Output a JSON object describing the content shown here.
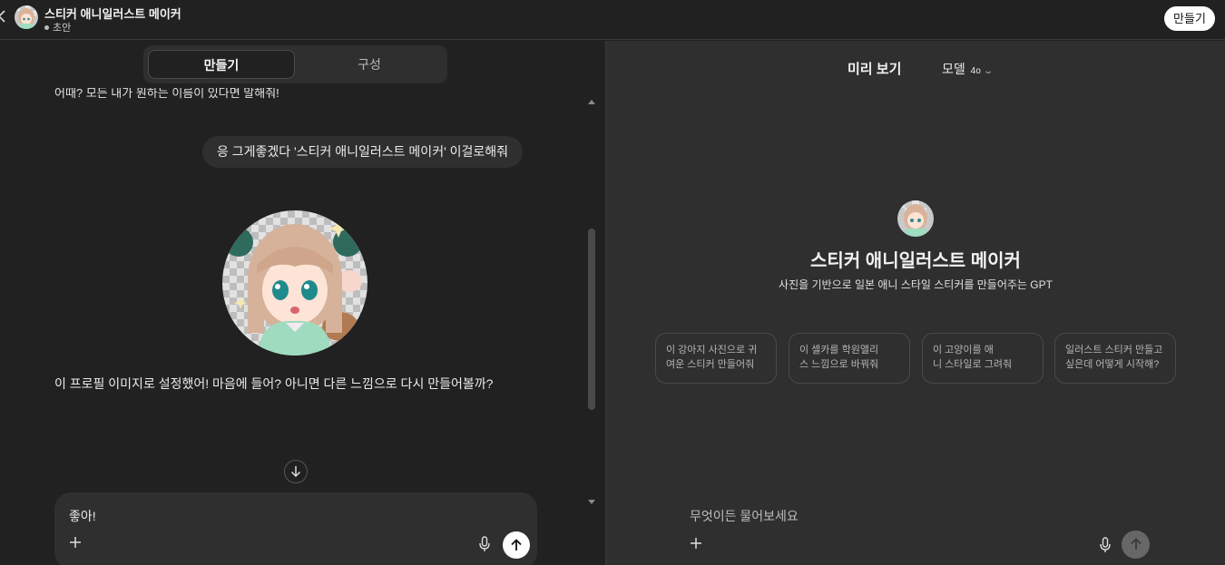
{
  "header": {
    "title": "스티커 애니일러스트 메이커",
    "status": "초안",
    "create_label": "만들기"
  },
  "builder": {
    "tabs": [
      {
        "label": "만들기",
        "active": true
      },
      {
        "label": "구성",
        "active": false
      }
    ],
    "partial_message": "어때? 모든 내가 원하는 이름이 있다면 말해줘!",
    "user_message": "응 그게좋겠다 '스티커 애니일러스트 메이커' 이걸로해줘",
    "assistant_message": "이 프로필 이미지로 설정했어! 마음에 들어? 아니면 다른 느낌으로 다시 만들어볼까?",
    "composer_text": "좋아!"
  },
  "preview": {
    "title": "미리 보기",
    "model_label": "모델",
    "model_version": "4o",
    "gpt_name": "스티커 애니일러스트 메이커",
    "gpt_description": "사진을 기반으로 일본 애니 스타일 스티커를 만들어주는 GPT",
    "starters": [
      {
        "line1": "이 강아지 사진으로 귀",
        "line2": "여운 스티커 만들어줘"
      },
      {
        "line1": "이 셀카를 학원앨리",
        "line2": "스 느낌으로 바꿔줘"
      },
      {
        "line1": "이 고양이를 애",
        "line2": "니 스타일로 그려줘"
      },
      {
        "line1": "일러스트 스티커 만들고",
        "line2": "싶은데 어떻게 시작해?"
      }
    ],
    "composer_placeholder": "무엇이든 물어보세요"
  },
  "icons": {
    "back": "back-chevron-icon",
    "plus": "plus-icon",
    "mic": "microphone-icon",
    "send": "arrow-up-icon",
    "jump": "arrow-down-icon",
    "model_chevron": "chevron-down-icon"
  },
  "colors": {
    "bg_left": "#212121",
    "bg_right": "#2f2f2f",
    "bubble": "#2f2f2f",
    "send_active": "#ffffff",
    "send_disabled": "#676767"
  }
}
